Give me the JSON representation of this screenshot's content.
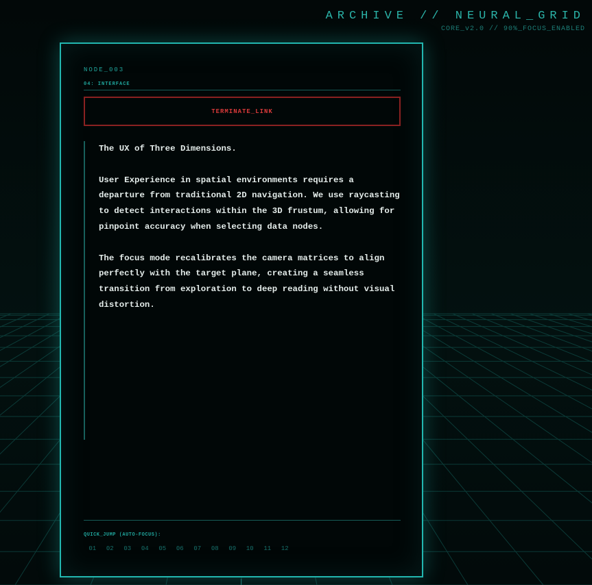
{
  "header": {
    "title": "ARCHIVE // NEURAL_GRID",
    "subtitle": "CORE_v2.0 // 90%_FOCUS_ENABLED"
  },
  "panel": {
    "node_id": "NODE_003",
    "section_label": "04: INTERFACE",
    "terminate_label": "TERMINATE_LINK",
    "heading": "The UX of Three Dimensions.",
    "paragraphs": [
      "User Experience in spatial environments requires a departure from traditional 2D navigation. We use raycasting to detect interactions within the 3D frustum, allowing for pinpoint accuracy when selecting data nodes.",
      "The focus mode recalibrates the camera matrices to align perfectly with the target plane, creating a seamless transition from exploration to deep reading without visual distortion."
    ],
    "quick_jump_label": "QUICK_JUMP (AUTO-FOCUS):",
    "quick_jump_items": [
      "01",
      "02",
      "03",
      "04",
      "05",
      "06",
      "07",
      "08",
      "09",
      "10",
      "11",
      "12"
    ]
  },
  "colors": {
    "accent": "#22b7b0",
    "danger": "#d93a3a",
    "text": "#e4ecea",
    "background": "#010707"
  }
}
